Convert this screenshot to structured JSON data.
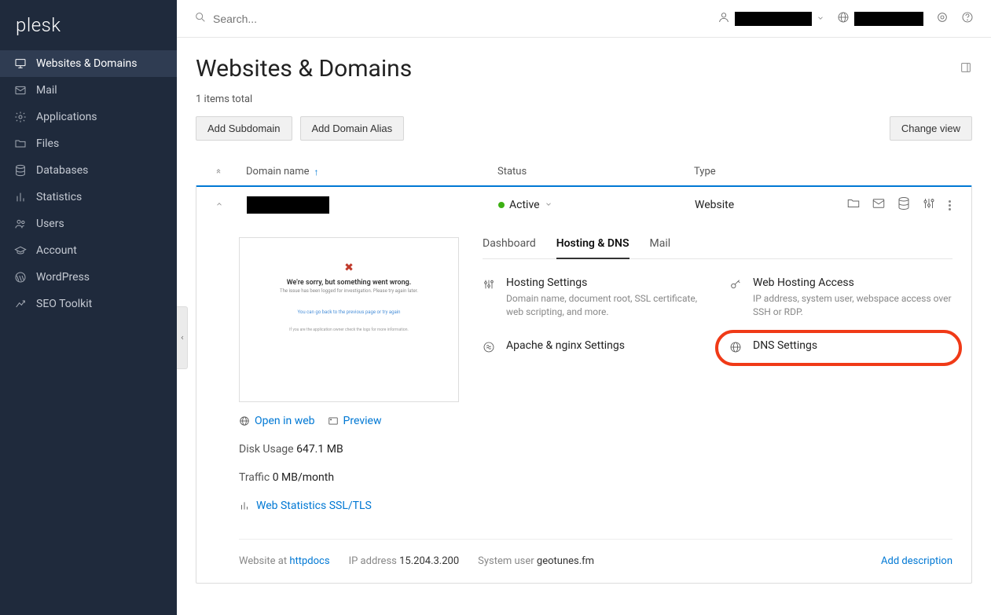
{
  "logo": "plesk",
  "search": {
    "placeholder": "Search..."
  },
  "sidebar": {
    "items": [
      {
        "label": "Websites & Domains",
        "icon": "monitor",
        "active": true
      },
      {
        "label": "Mail",
        "icon": "mail",
        "active": false
      },
      {
        "label": "Applications",
        "icon": "gear",
        "active": false
      },
      {
        "label": "Files",
        "icon": "folder",
        "active": false
      },
      {
        "label": "Databases",
        "icon": "database",
        "active": false
      },
      {
        "label": "Statistics",
        "icon": "bars",
        "active": false
      },
      {
        "label": "Users",
        "icon": "users",
        "active": false
      },
      {
        "label": "Account",
        "icon": "hat",
        "active": false
      },
      {
        "label": "WordPress",
        "icon": "wordpress",
        "active": false
      },
      {
        "label": "SEO Toolkit",
        "icon": "chart",
        "active": false
      }
    ]
  },
  "page": {
    "title": "Websites & Domains",
    "items_total": "1 items total"
  },
  "buttons": {
    "add_subdomain": "Add Subdomain",
    "add_alias": "Add Domain Alias",
    "change_view": "Change view"
  },
  "columns": {
    "domain": "Domain name",
    "status": "Status",
    "type": "Type"
  },
  "domain": {
    "status": "Active",
    "type": "Website",
    "preview_error_title": "We're sorry, but something went wrong.",
    "open_in_web": "Open in web",
    "preview": "Preview",
    "disk_label": "Disk Usage",
    "disk_value": "647.1 MB",
    "traffic_label": "Traffic",
    "traffic_value": "0 MB/month",
    "web_stats": "Web Statistics SSL/TLS"
  },
  "tabs": {
    "dashboard": "Dashboard",
    "hosting": "Hosting & DNS",
    "mail": "Mail"
  },
  "tools": {
    "hosting_settings": {
      "title": "Hosting Settings",
      "desc": "Domain name, document root, SSL certificate, web scripting, and more."
    },
    "web_hosting_access": {
      "title": "Web Hosting Access",
      "desc": "IP address, system user, webspace access over SSH or RDP."
    },
    "apache": {
      "title": "Apache & nginx Settings"
    },
    "dns": {
      "title": "DNS Settings"
    }
  },
  "footer": {
    "website_at_label": "Website at",
    "website_at_value": "httpdocs",
    "ip_label": "IP address",
    "ip_value": "15.204.3.200",
    "sysuser_label": "System user",
    "sysuser_value": "geotunes.fm",
    "add_desc": "Add description"
  }
}
